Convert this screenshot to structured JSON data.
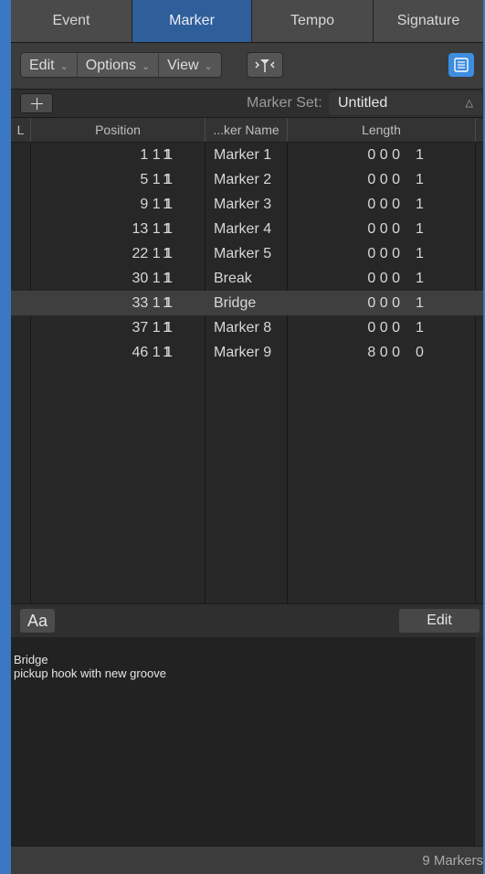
{
  "tabs": [
    "Event",
    "Marker",
    "Tempo",
    "Signature"
  ],
  "active_tab": "Marker",
  "toolbar": {
    "edit_label": "Edit",
    "options_label": "Options",
    "view_label": "View",
    "catch_icon": "catch-playhead-icon",
    "list_icon": "list-view-icon"
  },
  "marker_set": {
    "label": "Marker Set:",
    "value": "Untitled"
  },
  "columns": {
    "lock": "L",
    "position": "Position",
    "name": "...ker Name",
    "length": "Length"
  },
  "rows": [
    {
      "pos": "1 1 1",
      "pos_tick": "1",
      "name": "Marker 1",
      "len": "0 0 0",
      "len_tick": "1"
    },
    {
      "pos": "5 1 1",
      "pos_tick": "1",
      "name": "Marker 2",
      "len": "0 0 0",
      "len_tick": "1"
    },
    {
      "pos": "9 1 1",
      "pos_tick": "1",
      "name": "Marker 3",
      "len": "0 0 0",
      "len_tick": "1"
    },
    {
      "pos": "13 1 1",
      "pos_tick": "1",
      "name": "Marker 4",
      "len": "0 0 0",
      "len_tick": "1"
    },
    {
      "pos": "22 1 1",
      "pos_tick": "1",
      "name": "Marker 5",
      "len": "0 0 0",
      "len_tick": "1"
    },
    {
      "pos": "30 1 1",
      "pos_tick": "1",
      "name": "Break",
      "len": "0 0 0",
      "len_tick": "1"
    },
    {
      "pos": "33 1 1",
      "pos_tick": "1",
      "name": "Bridge",
      "len": "0 0 0",
      "len_tick": "1"
    },
    {
      "pos": "37 1 1",
      "pos_tick": "1",
      "name": "Marker 8",
      "len": "0 0 0",
      "len_tick": "1"
    },
    {
      "pos": "46 1 1",
      "pos_tick": "1",
      "name": "Marker 9",
      "len": "8 0 0",
      "len_tick": "0"
    }
  ],
  "selected_row": "Bridge",
  "notes": {
    "font_button": "Aa",
    "edit_button": "Edit",
    "title": "Bridge",
    "text": "pickup hook with new groove"
  },
  "status": "9 Markers",
  "colors": {
    "accent": "#3a78c3",
    "active_tab": "#2f5f9a",
    "list_button": "#3d8de0"
  }
}
